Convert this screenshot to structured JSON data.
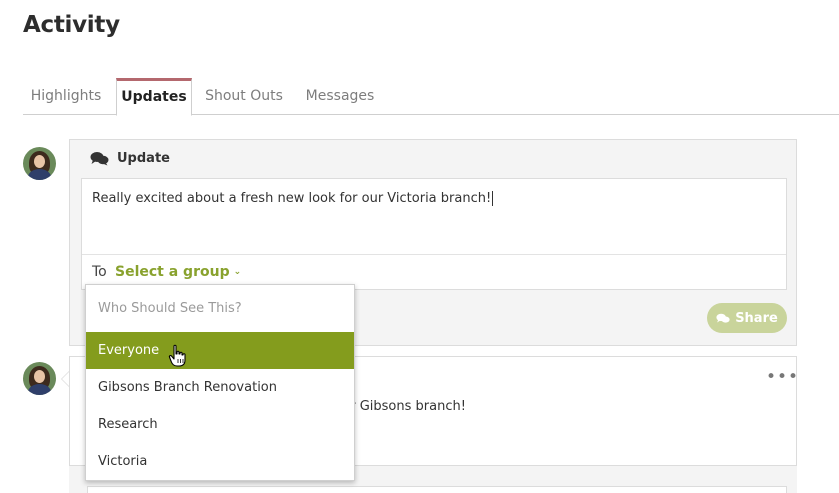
{
  "page": {
    "title": "Activity"
  },
  "tabs": [
    {
      "label": "Highlights",
      "active": false
    },
    {
      "label": "Updates",
      "active": true
    },
    {
      "label": "Shout Outs",
      "active": false
    },
    {
      "label": "Messages",
      "active": false
    }
  ],
  "composer": {
    "header_label": "Update",
    "header_icon": "chat-bubbles-icon",
    "text": "Really excited about a fresh new look for our Victoria branch!",
    "to_label": "To",
    "group_select_label": "Select a group",
    "share_label": "Share"
  },
  "dropdown": {
    "header": "Who Should See This?",
    "options": [
      "Everyone",
      "Gibsons Branch Renovation",
      "Research",
      "Victoria"
    ],
    "highlighted": "Everyone"
  },
  "post": {
    "text_fragment": "ur Gibsons branch!"
  },
  "colors": {
    "accent_green": "#89a22e",
    "selected_green": "#849c1d",
    "share_disabled": "#c9d49b",
    "active_tab_border": "#b4686e"
  }
}
